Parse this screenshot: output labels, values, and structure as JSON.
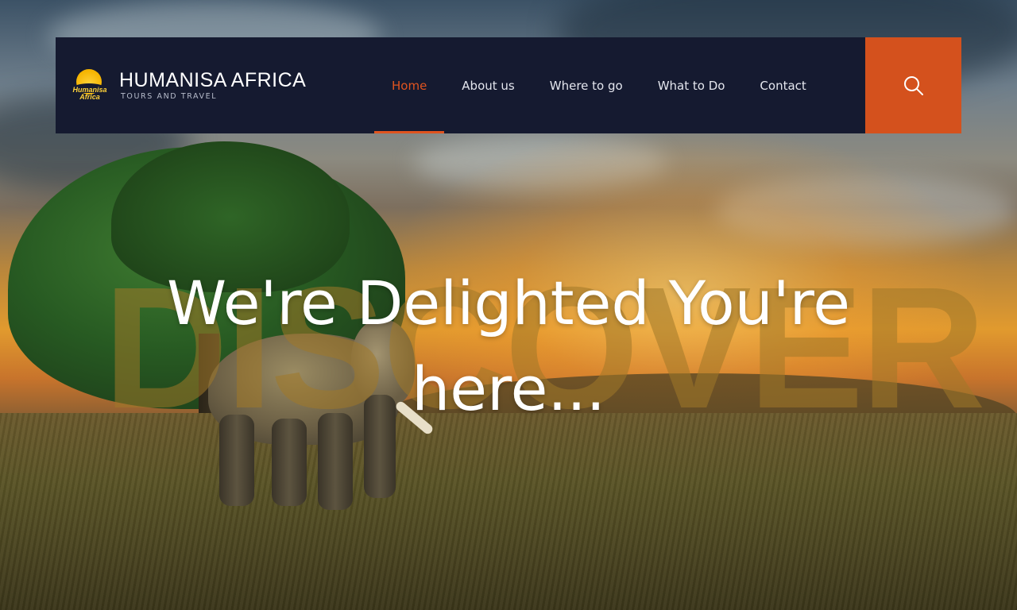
{
  "brand": {
    "logo_text": "Humanisa Africa",
    "name": "HUMANISA AFRICA",
    "tagline": "TOURS AND TRAVEL"
  },
  "nav": {
    "items": [
      {
        "label": "Home",
        "active": true
      },
      {
        "label": "About us",
        "active": false
      },
      {
        "label": "Where to go",
        "active": false
      },
      {
        "label": "What to Do",
        "active": false
      },
      {
        "label": "Contact",
        "active": false
      }
    ]
  },
  "search": {
    "icon": "search-icon"
  },
  "hero": {
    "background_word": "DISCOVER",
    "headline_line1": "We're Delighted You're",
    "headline_line2": "here..."
  },
  "colors": {
    "header_bg": "#151a30",
    "accent": "#e0541f",
    "search_bg": "#d4511d"
  }
}
